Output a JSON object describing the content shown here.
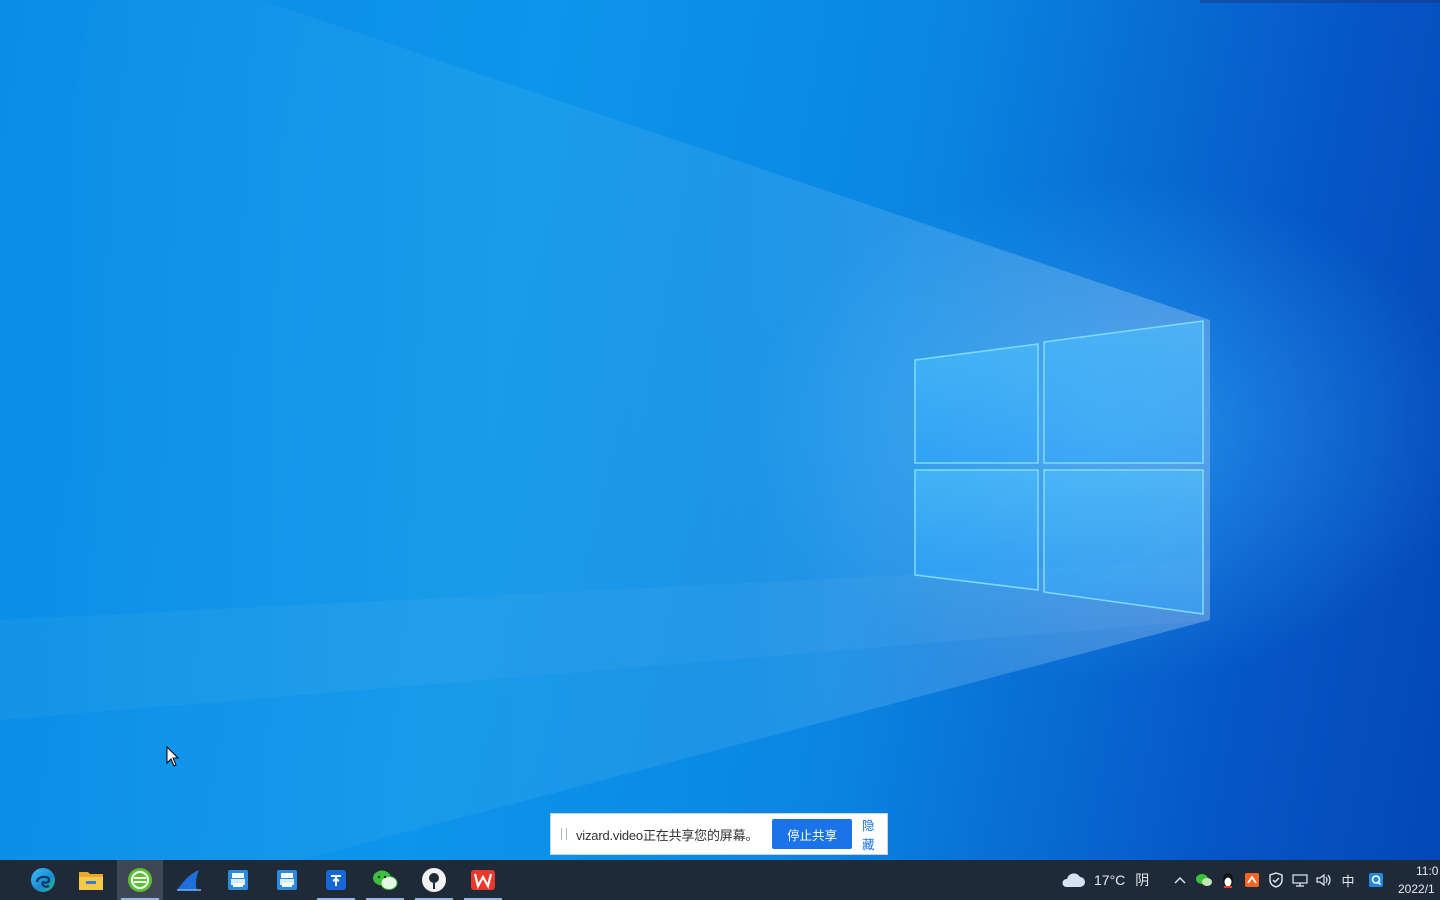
{
  "desktop": {
    "wallpaper": "windows-10-hero",
    "accent_color": "#0a8de6"
  },
  "share_bar": {
    "message": "vizard.video正在共享您的屏幕。",
    "stop_label": "停止共享",
    "hide_label": "隐藏"
  },
  "taskbar": {
    "apps": [
      {
        "name": "edge-icon",
        "state": "normal"
      },
      {
        "name": "file-explorer-icon",
        "state": "normal"
      },
      {
        "name": "browser-green-icon",
        "state": "active"
      },
      {
        "name": "shark-icon",
        "state": "normal"
      },
      {
        "name": "printer-app-icon",
        "state": "normal"
      },
      {
        "name": "printer-app-2-icon",
        "state": "normal"
      },
      {
        "name": "blue-app-icon",
        "state": "running"
      },
      {
        "name": "wechat-icon",
        "state": "running"
      },
      {
        "name": "record-app-icon",
        "state": "running"
      },
      {
        "name": "wps-icon",
        "state": "running"
      }
    ],
    "weather": {
      "temperature": "17°C",
      "condition": "阴"
    },
    "tray": {
      "ime": "中"
    },
    "clock": {
      "time": "11:0",
      "date": "2022/1"
    }
  }
}
